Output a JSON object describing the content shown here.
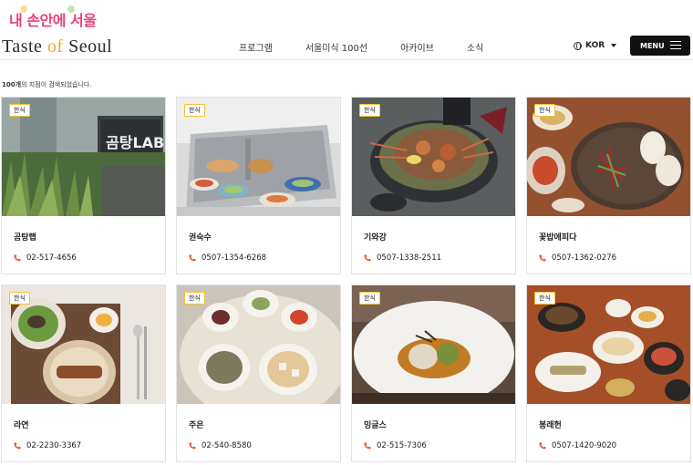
{
  "site": {
    "portal_logo": "내 손안에 서울",
    "brand_left": "Taste",
    "brand_mid": "of",
    "brand_right": "Seoul"
  },
  "nav": {
    "items": [
      {
        "label": "프로그램"
      },
      {
        "label": "서울미식 100선"
      },
      {
        "label": "아카이브"
      },
      {
        "label": "소식"
      }
    ],
    "language": "KOR",
    "menu_label": "MENU"
  },
  "results": {
    "count": "100개",
    "suffix": "의 지점이 검색되었습니다."
  },
  "restaurants": [
    {
      "category": "한식",
      "name": "곰탕랩",
      "phone": "02-517-4656",
      "sign_text": "곰탕LAB"
    },
    {
      "category": "한식",
      "name": "권숙수",
      "phone": "0507-1354-6268"
    },
    {
      "category": "한식",
      "name": "기와강",
      "phone": "0507-1338-2511"
    },
    {
      "category": "한식",
      "name": "꽃밥에피다",
      "phone": "0507-1362-0276"
    },
    {
      "category": "한식",
      "name": "라연",
      "phone": "02-2230-3367"
    },
    {
      "category": "한식",
      "name": "주은",
      "phone": "02-540-8580"
    },
    {
      "category": "한식",
      "name": "밍글스",
      "phone": "02-515-7306"
    },
    {
      "category": "한식",
      "name": "봉래헌",
      "phone": "0507-1420-9020"
    }
  ],
  "colors": {
    "accent_pink": "#e9427a",
    "badge_border": "#f1c232",
    "phone_icon": "#e8552b",
    "menu_bg": "#111111"
  }
}
